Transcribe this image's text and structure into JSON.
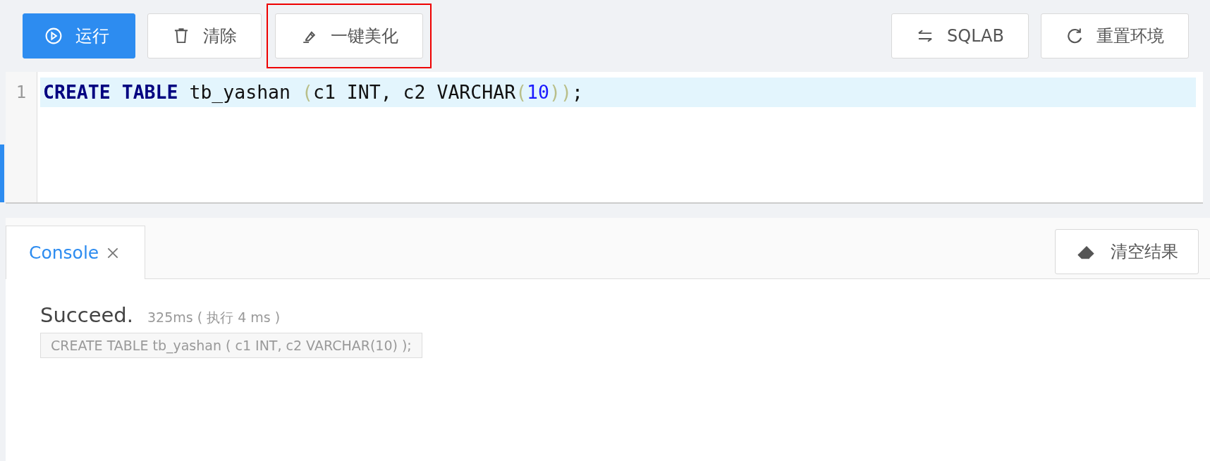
{
  "toolbar": {
    "left": [
      {
        "label": "运行",
        "kind": "run",
        "primary": true,
        "highlighted": false
      },
      {
        "label": "清除",
        "kind": "clear",
        "primary": false,
        "highlighted": false
      },
      {
        "label": "一键美化",
        "kind": "beautify",
        "primary": false,
        "highlighted": true
      }
    ],
    "right": [
      {
        "label": "SQLAB",
        "kind": "swap",
        "primary": false,
        "highlighted": false
      },
      {
        "label": "重置环境",
        "kind": "reset",
        "primary": false,
        "highlighted": false
      }
    ]
  },
  "editor": {
    "lines": [
      {
        "number": "1",
        "tokens": [
          {
            "text": "CREATE ",
            "kind": "keyword"
          },
          {
            "text": "TABLE",
            "kind": "keyword"
          },
          {
            "text": " tb_yashan ",
            "kind": "plain"
          },
          {
            "text": "(",
            "kind": "bracket"
          },
          {
            "text": "c1 INT, c2 VARCHAR",
            "kind": "plain"
          },
          {
            "text": "(",
            "kind": "bracket"
          },
          {
            "text": "10",
            "kind": "number"
          },
          {
            "text": "))",
            "kind": "bracket"
          },
          {
            "text": ";",
            "kind": "plain"
          }
        ]
      }
    ]
  },
  "console": {
    "tabs": [
      {
        "label": "Console",
        "selected": true
      }
    ],
    "clear_button": "清空结果",
    "result": {
      "status": "Succeed.",
      "timing": "325ms ( 执行 4 ms )",
      "statement": "CREATE TABLE tb_yashan ( c1 INT, c2 VARCHAR(10) );"
    }
  }
}
